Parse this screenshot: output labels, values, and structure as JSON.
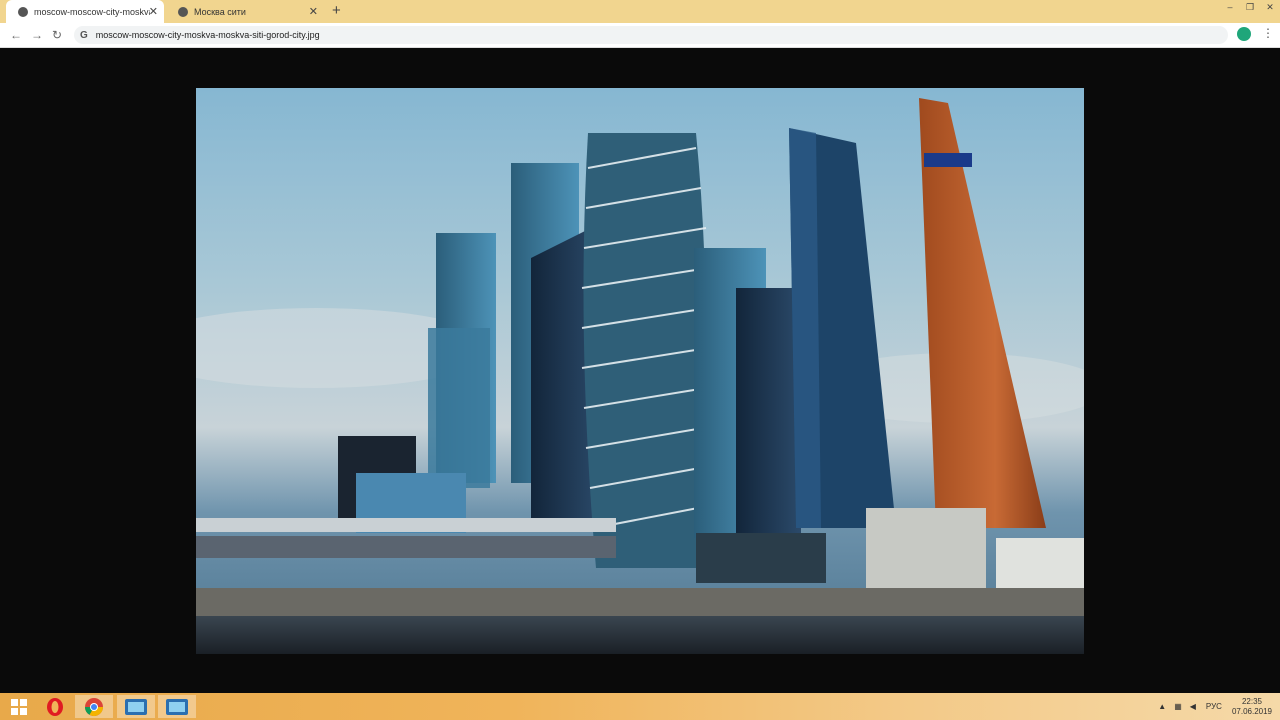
{
  "browser": {
    "tabs": [
      {
        "title": "moscow-moscow-city-moskva-m",
        "active": true
      },
      {
        "title": "Москва сити",
        "active": false
      }
    ],
    "new_tab": "+",
    "close_glyph": "✕",
    "window_controls": [
      "–",
      "❐",
      "✕"
    ],
    "nav": {
      "back": "←",
      "forward": "→",
      "reload": "↻"
    },
    "omnibox": {
      "security_icon": "G",
      "url": "moscow-moscow-city-moskva-moskva-siti-gorod-city.jpg"
    },
    "menu_glyph": "⋮"
  },
  "viewer": {
    "image_name": "moscow-moscow-city-moskva-moskva-siti-gorod-city.jpg",
    "background": "#0a0a0a"
  },
  "taskbar": {
    "start_icon": "windows-logo-icon",
    "pinned": [
      "opera-icon",
      "chrome-icon",
      "app-icon-1",
      "app-icon-2"
    ],
    "tray": {
      "language": "РУС",
      "time": "22:35",
      "date": "07.06.2019"
    }
  },
  "colors": {
    "tabstrip": "#f1d58f",
    "taskbar": "#e8a94a"
  }
}
